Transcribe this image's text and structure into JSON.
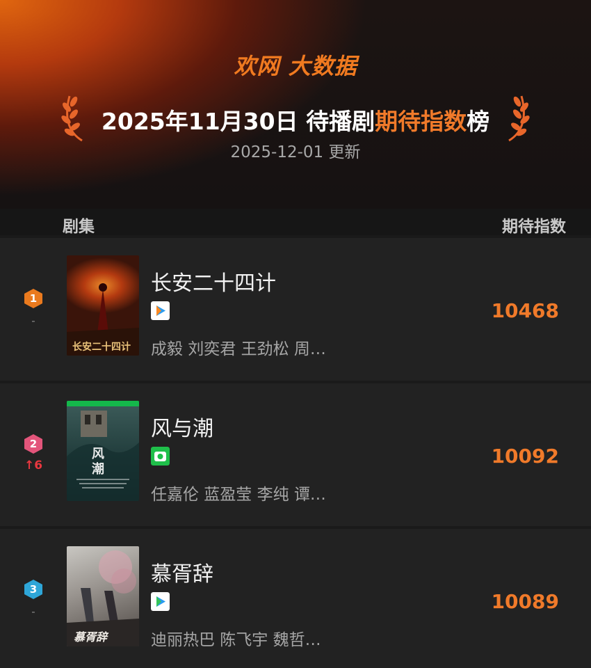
{
  "header": {
    "logo_text": "欢网 大数据",
    "title_prefix": "2025年11月30日 待播剧",
    "title_highlight": "期待指数",
    "title_suffix": "榜",
    "update_text": "2025-12-01 更新"
  },
  "columns": {
    "series": "剧集",
    "index": "期待指数"
  },
  "rows": [
    {
      "rank": "1",
      "change": "-",
      "title": "长安二十四计",
      "platform_icon": "tencent-video-icon",
      "cast": "成毅 刘奕君 王劲松 周…",
      "score": "10468",
      "badge_color": "#ea7a1e"
    },
    {
      "rank": "2",
      "change": "6",
      "title": "风与潮",
      "platform_icon": "iqiyi-icon",
      "cast": "任嘉伦 蓝盈莹 李纯 谭…",
      "score": "10092",
      "badge_color": "#e3557b"
    },
    {
      "rank": "3",
      "change": "-",
      "title": "慕胥辞",
      "platform_icon": "tencent-video-icon",
      "cast": "迪丽热巴 陈飞宇 魏哲…",
      "score": "10089",
      "badge_color": "#2ea6d8"
    }
  ]
}
